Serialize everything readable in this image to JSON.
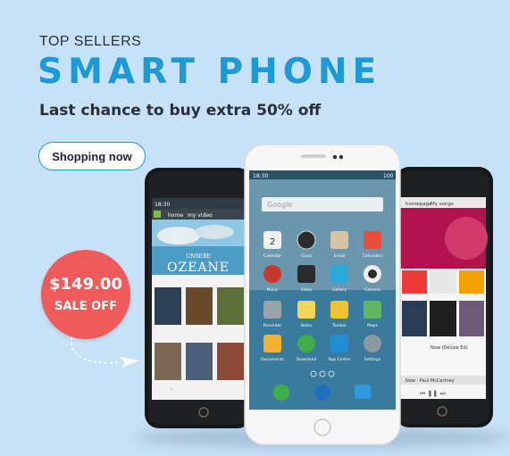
{
  "promo": {
    "kicker": "TOP SELLERS",
    "headline": "SMART PHONE",
    "tagline": "Last chance to buy extra 50% off",
    "cta_label": "Shopping now"
  },
  "badge": {
    "price": "$149.00",
    "label": "SALE OFF"
  },
  "phone_center": {
    "status_time": "18:30",
    "status_battery": "100",
    "search_placeholder": "Google",
    "calendar_day": "2",
    "apps": [
      "Calendar",
      "Clock",
      "Email",
      "Calculator",
      "Music",
      "Video",
      "Gallery",
      "Camera",
      "Recorder",
      "Notes",
      "Toolbar",
      "Maps",
      "Documents",
      "Download",
      "App Center",
      "Settings"
    ]
  },
  "phone_left": {
    "status_time": "18:30",
    "tabs": [
      "home",
      "my video"
    ],
    "movie_title_small": "UNSERE",
    "movie_title": "OZEANE"
  },
  "phone_right": {
    "tabs": [
      "homepage",
      "My songs"
    ],
    "album_caption": "Now (Deluxe Ed)",
    "player_caption": "Now - Paul McCartney"
  },
  "colors": {
    "background": "#c7e1f7",
    "accent": "#1d9ad6",
    "badge": "#ef5a5b",
    "text": "#2b2f38"
  }
}
